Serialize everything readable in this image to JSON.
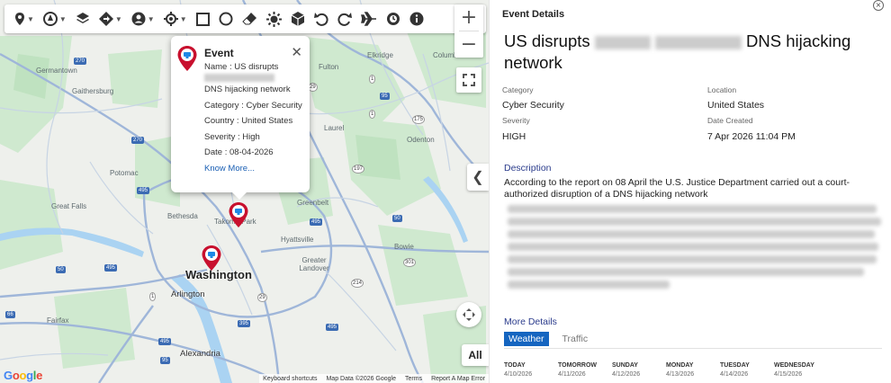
{
  "map": {
    "labels": {
      "germantown": "Germantown",
      "gaithersburg": "Gaithersburg",
      "potomac": "Potomac",
      "great_falls": "Great Falls",
      "bethesda": "Bethesda",
      "takoma_park": "Takoma Park",
      "hyattsville": "Hyattsville",
      "greenbelt": "Greenbelt",
      "greater_landover": "Greater Landover",
      "bowie": "Bowie",
      "washington": "Washington",
      "arlington": "Arlington",
      "fairfax": "Fairfax",
      "alexandria": "Alexandria",
      "laurel": "Laurel",
      "odenton": "Odenton",
      "elkridge": "Elkridge",
      "columbia": "Columbia",
      "fulton": "Fulton"
    },
    "shields": [
      "270",
      "270",
      "495",
      "95",
      "197",
      "29",
      "495",
      "50",
      "50",
      "301",
      "214",
      "495",
      "66",
      "395",
      "495",
      "95",
      "495",
      "1",
      "1",
      "175",
      "29",
      "29",
      "1"
    ],
    "zoom_in": "+",
    "zoom_out": "−",
    "all_label": "All",
    "google_logo": "Google",
    "attribution": {
      "keyboard": "Keyboard shortcuts",
      "data": "Map Data ©2026 Google",
      "terms": "Terms",
      "report": "Report A Map Error"
    }
  },
  "toolbar": {
    "icons": [
      "pin-icon",
      "layers-pin-icon",
      "layers-icon",
      "diamond-icon",
      "person-icon",
      "target-icon",
      "square-icon",
      "circle-icon",
      "eraser-icon",
      "sun-icon",
      "cube-icon",
      "undo-icon",
      "redo-icon",
      "plane-icon",
      "clock-icon",
      "info-icon"
    ]
  },
  "popup": {
    "title": "Event",
    "name_label": "Name :",
    "name_prefix": "US disrupts",
    "name_suffix": "DNS hijacking network",
    "category_label": "Category :",
    "category_value": "Cyber Security",
    "country_label": "Country :",
    "country_value": "United States",
    "severity_label": "Severity :",
    "severity_value": "High",
    "date_label": "Date :",
    "date_value": "08-04-2026",
    "link": "Know More..."
  },
  "panel": {
    "header": "Event Details",
    "close": "×",
    "headline_prefix": "US disrupts",
    "headline_suffix": "DNS hijacking network",
    "category_label": "Category",
    "category_value": "Cyber Security",
    "location_label": "Location",
    "location_value": "United States",
    "severity_label": "Severity",
    "severity_value": "HIGH",
    "date_label": "Date Created",
    "date_value": "7 Apr 2026 11:04 PM",
    "description_heading": "Description",
    "description_text": "According to the report on 08 April the U.S. Justice Department carried out a court-authorized disruption of a DNS hijacking network",
    "more_details": "More Details",
    "tabs": [
      "Weather",
      "Traffic"
    ],
    "days": [
      {
        "name": "TODAY",
        "date": "4/10/2026"
      },
      {
        "name": "TOMORROW",
        "date": "4/11/2026"
      },
      {
        "name": "SUNDAY",
        "date": "4/12/2026"
      },
      {
        "name": "MONDAY",
        "date": "4/13/2026"
      },
      {
        "name": "TUESDAY",
        "date": "4/14/2026"
      },
      {
        "name": "WEDNESDAY",
        "date": "4/15/2026"
      }
    ]
  }
}
